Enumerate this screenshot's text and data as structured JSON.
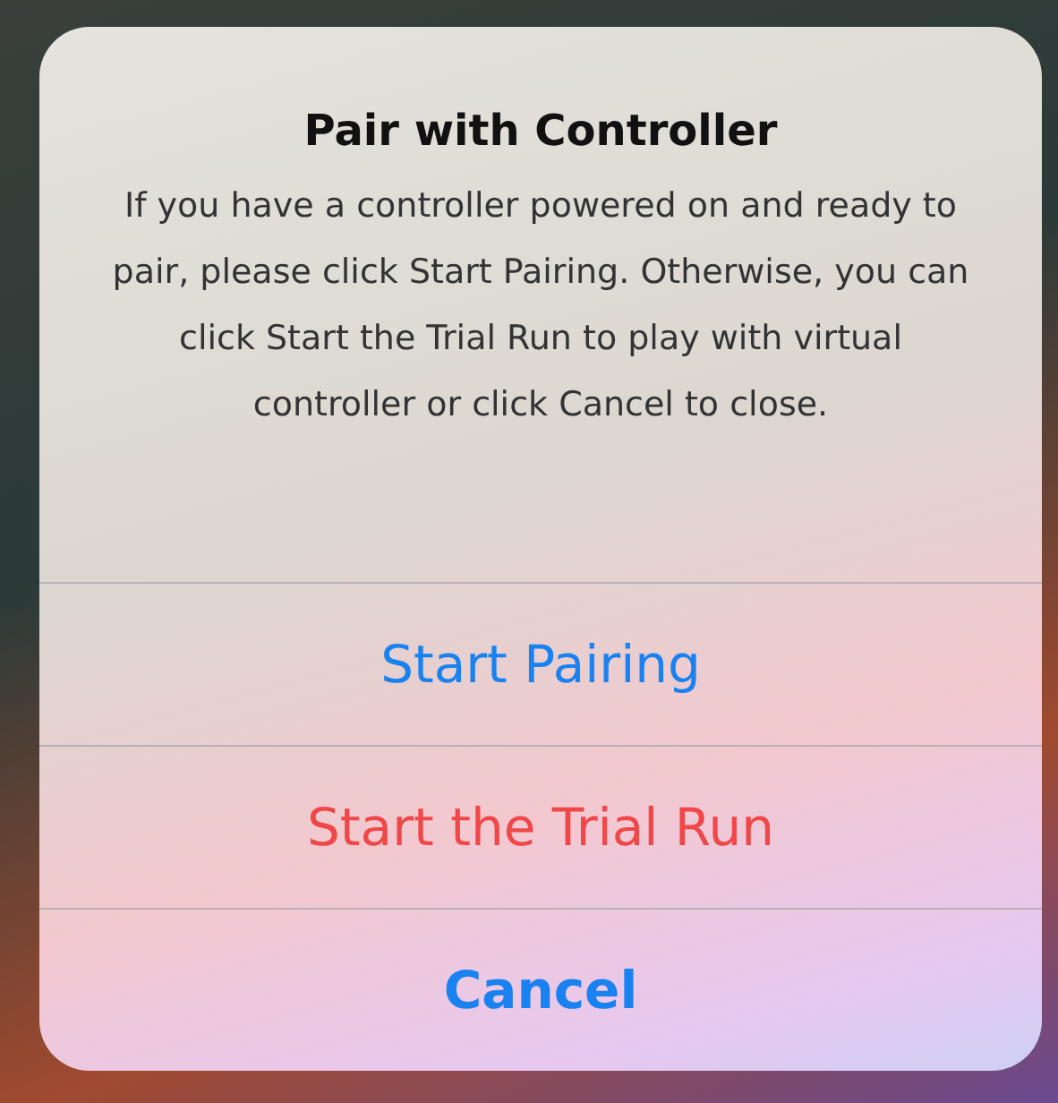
{
  "alert": {
    "title": "Pair with Controller",
    "message": "If you have a controller powered on and ready to pair, please click Start Pairing. Otherwise, you can click Start the Trial Run to play with virtual controller or click Cancel to close.",
    "actions": [
      {
        "label": "Start Pairing",
        "kind": "default"
      },
      {
        "label": "Start the Trial Run",
        "kind": "destructive"
      },
      {
        "label": "Cancel",
        "kind": "cancel"
      }
    ]
  }
}
